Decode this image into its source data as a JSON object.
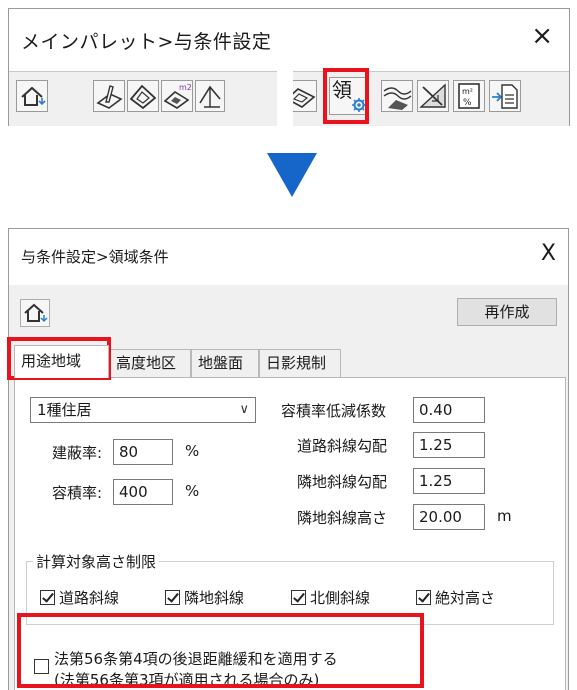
{
  "palette": {
    "title": "メインパレット>与条件設定",
    "close": "×",
    "highlighted_tool_glyph": "領",
    "tools": [
      {
        "icon": "home-icon"
      },
      {
        "icon": "site-draw-icon"
      },
      {
        "icon": "site-area-icon"
      },
      {
        "icon": "area-m2-icon"
      },
      {
        "icon": "shadow-icon"
      },
      {
        "icon": "plane-icon"
      },
      {
        "icon": "region-settings-icon",
        "glyph": "領"
      },
      {
        "icon": "road-icon"
      },
      {
        "icon": "slope-icon"
      },
      {
        "icon": "ratio-icon",
        "glyph": "m²\n%"
      },
      {
        "icon": "export-icon"
      }
    ]
  },
  "arrow": {
    "color": "#1566c8",
    "icon": "down-arrow-icon"
  },
  "dialog": {
    "title": "与条件設定>領域条件",
    "close": "X",
    "recreate_label": "再作成",
    "tabs": [
      "用途地域",
      "高度地区",
      "地盤面",
      "日影規制"
    ],
    "active_tab": "用途地域",
    "zone": {
      "selected": "1種住居",
      "caret": "∨"
    },
    "coverage": {
      "label": "建蔽率:",
      "value": "80",
      "unit": "%"
    },
    "far": {
      "label": "容積率:",
      "value": "400",
      "unit": "%"
    },
    "far_reduction": {
      "label": "容積率低減係数",
      "value": "0.40"
    },
    "road_slope": {
      "label": "道路斜線勾配",
      "value": "1.25"
    },
    "adjacent_slope": {
      "label": "隣地斜線勾配",
      "value": "1.25"
    },
    "adjacent_height": {
      "label": "隣地斜線高さ",
      "value": "20.00",
      "unit": "m"
    },
    "height_limit": {
      "label": "計算対象高さ制限",
      "options": [
        {
          "label": "道路斜線",
          "checked": true
        },
        {
          "label": "隣地斜線",
          "checked": true
        },
        {
          "label": "北側斜線",
          "checked": true
        },
        {
          "label": "絶対高さ",
          "checked": true
        }
      ]
    },
    "article56": {
      "line1": "法第56条第4項の後退距離緩和を適用する",
      "line2": "(法第56条第3項が適用される場合のみ)",
      "checked": false
    }
  },
  "colors": {
    "highlight": "#e8131d",
    "arrow": "#1566c8",
    "panel_bg": "#f0f0f0"
  }
}
